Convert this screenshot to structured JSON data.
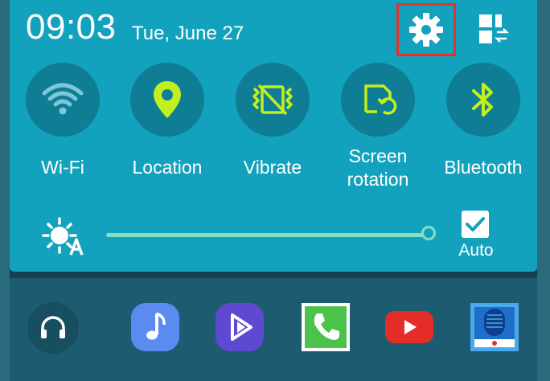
{
  "status": {
    "time": "09:03",
    "date": "Tue, June 27"
  },
  "quick_toggles": [
    {
      "label": "Wi-Fi",
      "icon": "wifi-icon",
      "state": "off"
    },
    {
      "label": "Location",
      "icon": "location-icon",
      "state": "on"
    },
    {
      "label": "Vibrate",
      "icon": "vibrate-icon",
      "state": "on"
    },
    {
      "label_line1": "Screen",
      "label_line2": "rotation",
      "icon": "screen-rotation-icon",
      "state": "on"
    },
    {
      "label": "Bluetooth",
      "icon": "bluetooth-icon",
      "state": "on"
    }
  ],
  "brightness": {
    "level": 0.95,
    "auto_label": "Auto",
    "auto_checked": true
  },
  "dock_apps": [
    {
      "name": "headphones-app",
      "icon": "headphones-icon"
    },
    {
      "name": "music-app",
      "icon": "music-note-icon"
    },
    {
      "name": "video-app",
      "icon": "play-icon"
    },
    {
      "name": "phone-app",
      "icon": "phone-icon"
    },
    {
      "name": "youtube-app",
      "icon": "youtube-icon"
    },
    {
      "name": "voice-recorder-app",
      "icon": "microphone-icon"
    }
  ],
  "colors": {
    "panel": "#13a2bd",
    "toggle_circle": "#0f7d94",
    "active_icon": "#c2ef1f",
    "inactive_icon": "#7cc8d8",
    "highlight": "#e5302c"
  }
}
